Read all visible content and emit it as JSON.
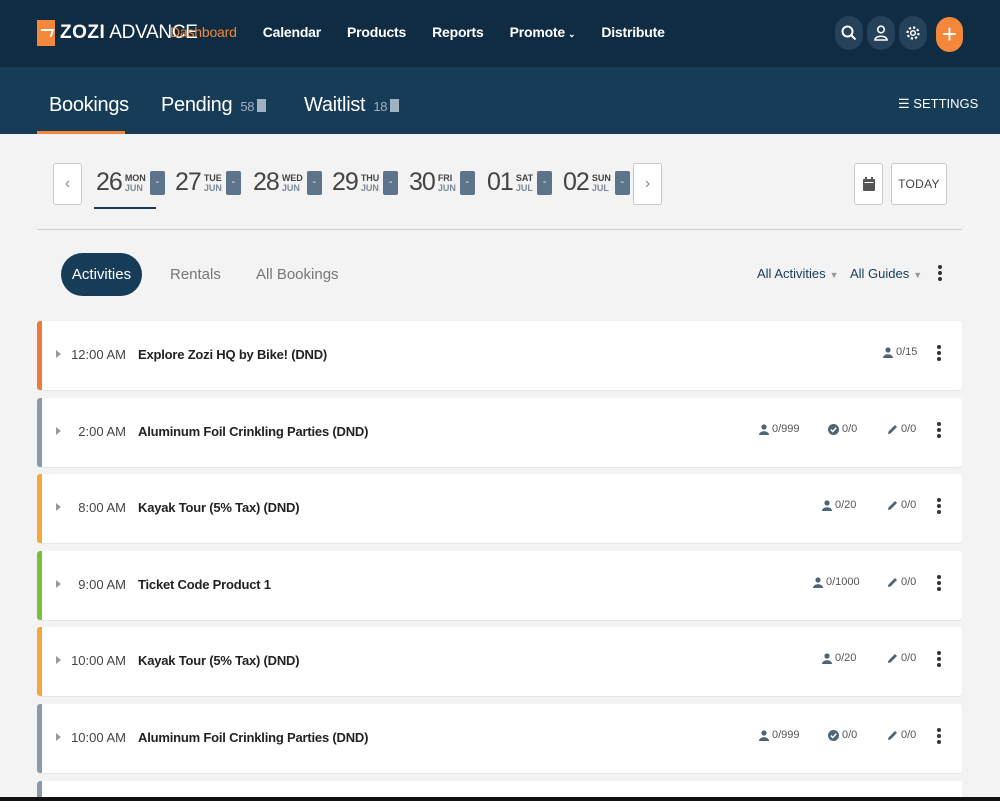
{
  "brand": {
    "name": "ZOZI",
    "product": "ADVANCE"
  },
  "nav": {
    "items": [
      "Dashboard",
      "Calendar",
      "Products",
      "Reports",
      "Promote",
      "Distribute"
    ],
    "active": "Dashboard"
  },
  "subnav": {
    "tabs": [
      {
        "label": "Bookings",
        "count": ""
      },
      {
        "label": "Pending",
        "count": "58"
      },
      {
        "label": "Waitlist",
        "count": "18"
      }
    ],
    "settings_label": "SETTINGS"
  },
  "dates": [
    {
      "day": "26",
      "dow": "MON",
      "month": "JUN",
      "marker": "-"
    },
    {
      "day": "27",
      "dow": "TUE",
      "month": "JUN",
      "marker": "-"
    },
    {
      "day": "28",
      "dow": "WED",
      "month": "JUN",
      "marker": "-"
    },
    {
      "day": "29",
      "dow": "THU",
      "month": "JUN",
      "marker": "-"
    },
    {
      "day": "30",
      "dow": "FRI",
      "month": "JUN",
      "marker": "-"
    },
    {
      "day": "01",
      "dow": "SAT",
      "month": "JUL",
      "marker": "-"
    },
    {
      "day": "02",
      "dow": "SUN",
      "month": "JUL",
      "marker": "-"
    }
  ],
  "today_label": "TODAY",
  "filters": {
    "tabs": [
      "Activities",
      "Rentals",
      "All Bookings"
    ],
    "active": "Activities",
    "activity_filter": "All Activities",
    "guide_filter": "All Guides"
  },
  "bookings": [
    {
      "time": "12:00 AM",
      "title": "Explore Zozi HQ by Bike! (DND)",
      "accent": "#f07a3e",
      "guests": "0/15",
      "checked": "",
      "edits": ""
    },
    {
      "time": "2:00 AM",
      "title": "Aluminum Foil Crinkling Parties (DND)",
      "accent": "#8b9aa8",
      "guests": "0/999",
      "checked": "0/0",
      "edits": "0/0"
    },
    {
      "time": "8:00 AM",
      "title": "Kayak Tour (5% Tax) (DND)",
      "accent": "#f5a73a",
      "guests": "0/20",
      "checked": "",
      "edits": "0/0"
    },
    {
      "time": "9:00 AM",
      "title": "Ticket Code Product 1",
      "accent": "#7cbf3a",
      "guests": "0/1000",
      "checked": "",
      "edits": "0/0"
    },
    {
      "time": "10:00 AM",
      "title": "Kayak Tour (5% Tax) (DND)",
      "accent": "#f5a73a",
      "guests": "0/20",
      "checked": "",
      "edits": "0/0"
    },
    {
      "time": "10:00 AM",
      "title": "Aluminum Foil Crinkling Parties (DND)",
      "accent": "#8b9aa8",
      "guests": "0/999",
      "checked": "0/0",
      "edits": "0/0"
    }
  ],
  "colors": {
    "nav_bg": "#0f2c43",
    "subnav_bg": "#163c57",
    "accent": "#f4873a"
  }
}
